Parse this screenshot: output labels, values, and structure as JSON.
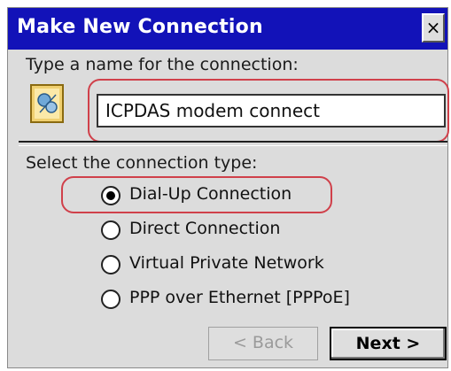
{
  "dialog": {
    "title": "Make New Connection",
    "close_label": "×",
    "name_prompt": "Type a name for the connection:",
    "name_value": "ICPDAS modem connect",
    "type_prompt": "Select the connection type:",
    "connection_types": [
      {
        "label": "Dial-Up Connection",
        "selected": true
      },
      {
        "label": "Direct Connection",
        "selected": false
      },
      {
        "label": "Virtual Private Network",
        "selected": false
      },
      {
        "label": "PPP over Ethernet [PPPoE]",
        "selected": false
      }
    ],
    "back_label": "< Back",
    "next_label": "Next >"
  },
  "colors": {
    "titlebar": "#1212b8",
    "highlight": "#d0404a",
    "dialog_bg": "#dcdcdc"
  },
  "icons": {
    "connection": "network-connection-icon",
    "close": "close-icon"
  }
}
